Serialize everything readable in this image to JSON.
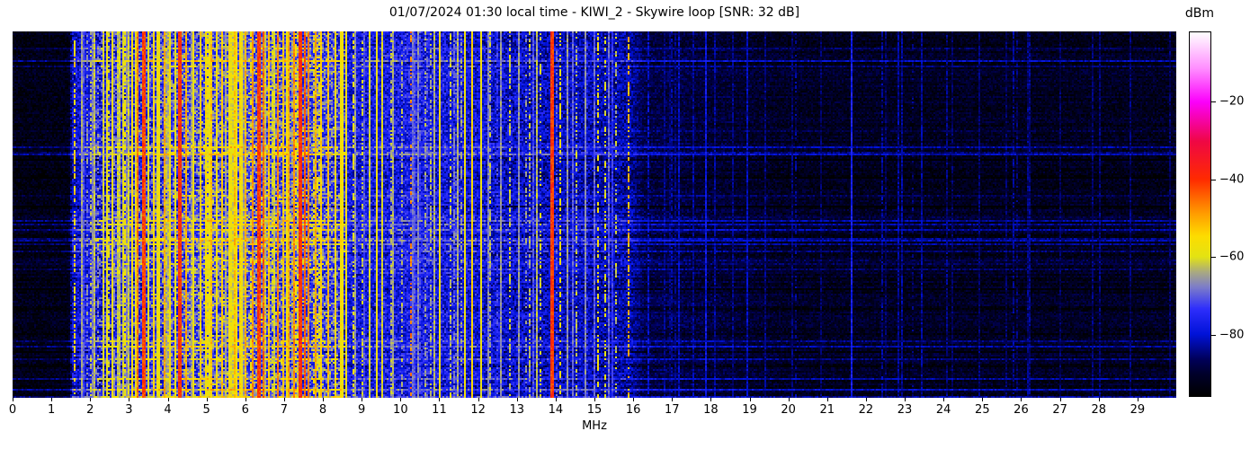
{
  "header": {
    "title": "01/07/2024 01:30 local time - KIWI_2 - Skywire loop [SNR: 32 dB]"
  },
  "chart_data": {
    "type": "heatmap",
    "title": "01/07/2024 01:30 local time - KIWI_2 - Skywire loop [SNR: 32 dB]",
    "xlabel": "MHz",
    "x_range": [
      0,
      30
    ],
    "x_ticks": [
      0,
      1,
      2,
      3,
      4,
      5,
      6,
      7,
      8,
      9,
      10,
      11,
      12,
      13,
      14,
      15,
      16,
      17,
      18,
      19,
      20,
      21,
      22,
      23,
      24,
      25,
      26,
      27,
      28,
      29
    ],
    "colorbar": {
      "label": "dBm",
      "ticks": [
        -20,
        -40,
        -60,
        -80
      ],
      "value_range": [
        -96,
        -2
      ]
    },
    "colormap_stops": [
      [
        0.0,
        "#000000"
      ],
      [
        0.06,
        "#00002a"
      ],
      [
        0.1,
        "#000058"
      ],
      [
        0.17,
        "#0012d8"
      ],
      [
        0.24,
        "#2e2efc"
      ],
      [
        0.3,
        "#7d7dc8"
      ],
      [
        0.34,
        "#a8a882"
      ],
      [
        0.383,
        "#e3e312"
      ],
      [
        0.44,
        "#fddc00"
      ],
      [
        0.5,
        "#ff9e00"
      ],
      [
        0.596,
        "#ff2a00"
      ],
      [
        0.7,
        "#ef0744"
      ],
      [
        0.809,
        "#fb00fb"
      ],
      [
        0.9,
        "#ff8dff"
      ],
      [
        1.0,
        "#ffffff"
      ]
    ],
    "seed": 20240107,
    "noise_floor_envelope_mhz_dbm": [
      [
        0.0,
        -93
      ],
      [
        1.45,
        -93
      ],
      [
        1.55,
        -80
      ],
      [
        2.1,
        -77
      ],
      [
        3.0,
        -74
      ],
      [
        4.5,
        -71
      ],
      [
        6.5,
        -70
      ],
      [
        8.3,
        -72
      ],
      [
        8.7,
        -78
      ],
      [
        9.3,
        -78
      ],
      [
        10.2,
        -77
      ],
      [
        12.0,
        -79
      ],
      [
        13.4,
        -81
      ],
      [
        14.6,
        -81
      ],
      [
        15.3,
        -82
      ],
      [
        15.95,
        -83
      ],
      [
        16.3,
        -88
      ],
      [
        18.5,
        -90
      ],
      [
        20.0,
        -91.5
      ],
      [
        30.0,
        -92
      ]
    ],
    "noise_bands": [
      {
        "f0": 0,
        "f1": 1.5,
        "amp": 3.5,
        "streak": 1.1
      },
      {
        "f0": 1.5,
        "f1": 2.1,
        "amp": 6,
        "streak": 1.2
      },
      {
        "f0": 2.1,
        "f1": 8.6,
        "amp": 10,
        "streak": 1.6
      },
      {
        "f0": 8.6,
        "f1": 13.8,
        "amp": 6.5,
        "streak": 1.0
      },
      {
        "f0": 13.8,
        "f1": 16,
        "amp": 5.5,
        "streak": 1.0
      },
      {
        "f0": 16,
        "f1": 30,
        "amp": 3.5,
        "streak": 1.2
      }
    ],
    "row_streaks": {
      "base": 3,
      "bright_prob": 0.12,
      "bright_add": [
        3,
        8
      ],
      "dark_prob": 0.08,
      "dark_add": [
        2,
        5
      ]
    },
    "carriers": [
      {
        "f": 1.58,
        "level": -54,
        "duty": 0.55
      },
      {
        "f": 2.45,
        "level": -60,
        "duty": 0.5
      },
      {
        "f": 2.56,
        "level": -57
      },
      {
        "f": 2.7,
        "level": -62
      },
      {
        "f": 2.85,
        "level": -60
      },
      {
        "f": 3.05,
        "level": -57
      },
      {
        "f": 3.2,
        "level": -46
      },
      {
        "f": 3.33,
        "level": -42,
        "w": 2
      },
      {
        "f": 3.48,
        "level": -58
      },
      {
        "f": 3.62,
        "level": -55
      },
      {
        "f": 3.75,
        "level": -57
      },
      {
        "f": 3.9,
        "level": -50
      },
      {
        "f": 4.05,
        "level": -56
      },
      {
        "f": 4.26,
        "level": -40,
        "w": 2
      },
      {
        "f": 4.47,
        "level": -50
      },
      {
        "f": 4.62,
        "level": -57
      },
      {
        "f": 4.8,
        "level": -54
      },
      {
        "f": 4.95,
        "level": -56
      },
      {
        "f": 5.1,
        "level": -52
      },
      {
        "f": 5.25,
        "level": -56
      },
      {
        "f": 5.4,
        "level": -53
      },
      {
        "f": 5.55,
        "level": -56
      },
      {
        "f": 5.7,
        "level": -52
      },
      {
        "f": 5.85,
        "level": -55
      },
      {
        "f": 6.0,
        "level": -51
      },
      {
        "f": 6.18,
        "level": -48
      },
      {
        "f": 6.3,
        "level": -41,
        "w": 2
      },
      {
        "f": 6.44,
        "level": -45
      },
      {
        "f": 6.6,
        "level": -52
      },
      {
        "f": 6.8,
        "level": -47
      },
      {
        "f": 6.95,
        "level": -53
      },
      {
        "f": 7.1,
        "level": -50
      },
      {
        "f": 7.25,
        "level": -48
      },
      {
        "f": 7.38,
        "level": -40,
        "w": 2
      },
      {
        "f": 7.5,
        "level": -44
      },
      {
        "f": 7.62,
        "level": -47
      },
      {
        "f": 7.8,
        "level": -50
      },
      {
        "f": 7.95,
        "level": -54
      },
      {
        "f": 8.1,
        "level": -52
      },
      {
        "f": 8.28,
        "level": -55
      },
      {
        "f": 8.45,
        "level": -56
      },
      {
        "f": 8.6,
        "level": -58
      },
      {
        "f": 8.78,
        "level": -59,
        "duty": 0.5
      },
      {
        "f": 9.0,
        "level": -61,
        "duty": 0.5
      },
      {
        "f": 9.2,
        "level": -60
      },
      {
        "f": 9.35,
        "level": -57
      },
      {
        "f": 9.5,
        "level": -60
      },
      {
        "f": 9.75,
        "level": -63,
        "duty": 0.6
      },
      {
        "f": 10.0,
        "level": -64,
        "duty": 0.5
      },
      {
        "f": 10.27,
        "level": -47,
        "duty": 0.35
      },
      {
        "f": 10.6,
        "level": -65,
        "duty": 0.5
      },
      {
        "f": 10.85,
        "level": -64
      },
      {
        "f": 11.0,
        "level": -56
      },
      {
        "f": 11.25,
        "level": -62,
        "duty": 0.6
      },
      {
        "f": 11.45,
        "level": -64
      },
      {
        "f": 11.65,
        "level": -58
      },
      {
        "f": 11.82,
        "level": -55
      },
      {
        "f": 12.05,
        "level": -58
      },
      {
        "f": 12.3,
        "level": -63,
        "duty": 0.6
      },
      {
        "f": 12.55,
        "level": -66
      },
      {
        "f": 12.78,
        "level": -61,
        "duty": 0.5
      },
      {
        "f": 13.05,
        "level": -66
      },
      {
        "f": 13.3,
        "level": -63,
        "duty": 0.5
      },
      {
        "f": 13.57,
        "level": -60,
        "duty": 0.4
      },
      {
        "f": 13.85,
        "level": -41,
        "w": 2
      },
      {
        "f": 14.1,
        "level": -57,
        "duty": 0.5
      },
      {
        "f": 14.3,
        "level": -66
      },
      {
        "f": 14.5,
        "level": -63,
        "duty": 0.5
      },
      {
        "f": 14.75,
        "level": -67
      },
      {
        "f": 15.05,
        "level": -57,
        "duty": 0.45
      },
      {
        "f": 15.25,
        "level": -59,
        "duty": 0.45
      },
      {
        "f": 15.55,
        "level": -63,
        "duty": 0.4
      },
      {
        "f": 15.86,
        "level": -51,
        "duty": 0.55
      },
      {
        "f": 16.35,
        "level": -81,
        "duty": 0.8
      },
      {
        "f": 16.8,
        "level": -85
      },
      {
        "f": 17.15,
        "level": -82
      },
      {
        "f": 17.55,
        "level": -84
      },
      {
        "f": 17.85,
        "level": -79
      },
      {
        "f": 18.1,
        "level": -84
      },
      {
        "f": 18.55,
        "level": -85
      },
      {
        "f": 18.92,
        "level": -82
      },
      {
        "f": 19.4,
        "level": -85
      },
      {
        "f": 20.1,
        "level": -86
      },
      {
        "f": 20.8,
        "level": -87
      },
      {
        "f": 21.6,
        "level": -77
      },
      {
        "f": 22.5,
        "level": -87
      },
      {
        "f": 23.4,
        "level": -84
      },
      {
        "f": 24.2,
        "level": -87
      },
      {
        "f": 24.9,
        "level": -86
      },
      {
        "f": 25.6,
        "level": -87
      },
      {
        "f": 26.2,
        "level": -85
      },
      {
        "f": 27.0,
        "level": -87
      },
      {
        "f": 27.8,
        "level": -86
      },
      {
        "f": 28.8,
        "level": -86
      }
    ],
    "procedural_line_bands": [
      {
        "f0": 2.15,
        "f1": 8.6,
        "count": 70,
        "level_min": -68,
        "level_max": -57
      },
      {
        "f0": 8.7,
        "f1": 13.7,
        "count": 20,
        "level_min": -72,
        "level_max": -63
      },
      {
        "f0": 14.0,
        "f1": 15.9,
        "count": 10,
        "level_min": -74,
        "level_max": -66
      },
      {
        "f0": 1.55,
        "f1": 2.1,
        "count": 7,
        "level_min": -72,
        "level_max": -62
      },
      {
        "f0": 16.1,
        "f1": 29.9,
        "count": 16,
        "level_min": -88,
        "level_max": -83
      }
    ]
  }
}
